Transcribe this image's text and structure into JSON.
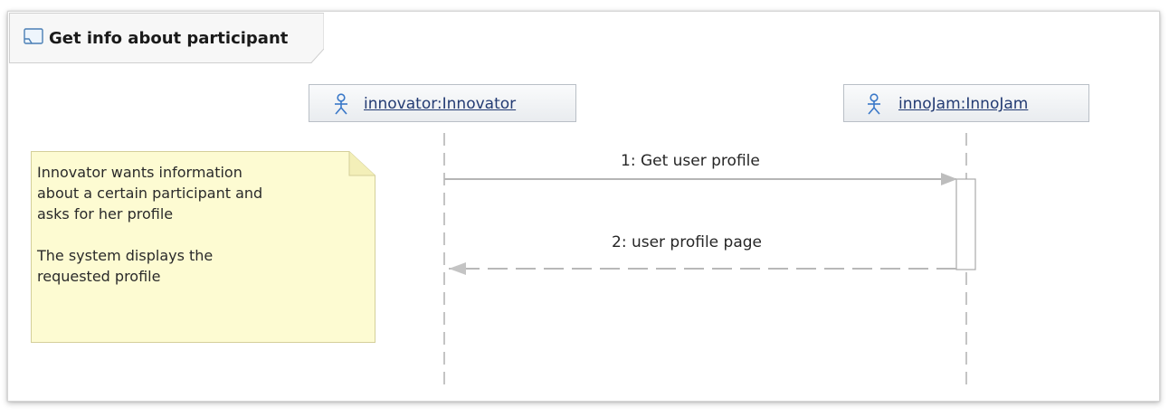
{
  "diagram": {
    "title": "Get info about participant",
    "title_icon": "diagram-frame-icon",
    "lifelines": [
      {
        "label": "innovator:Innovator",
        "icon": "actor-icon"
      },
      {
        "label": "innoJam:InnoJam",
        "icon": "actor-icon"
      }
    ],
    "messages": [
      {
        "label": "1: Get user profile",
        "kind": "synchronous"
      },
      {
        "label": "2: user profile page",
        "kind": "reply"
      }
    ],
    "note": {
      "text": "Innovator wants information\nabout a certain participant and\nasks for her profile\n\nThe system displays the\nrequested profile"
    },
    "colors": {
      "note_fill": "#fdfbd2",
      "note_border": "#d4cf9a",
      "lifeline_label": "#233b73",
      "actor_icon": "#3a78c8",
      "line": "#b0b0b0"
    }
  }
}
